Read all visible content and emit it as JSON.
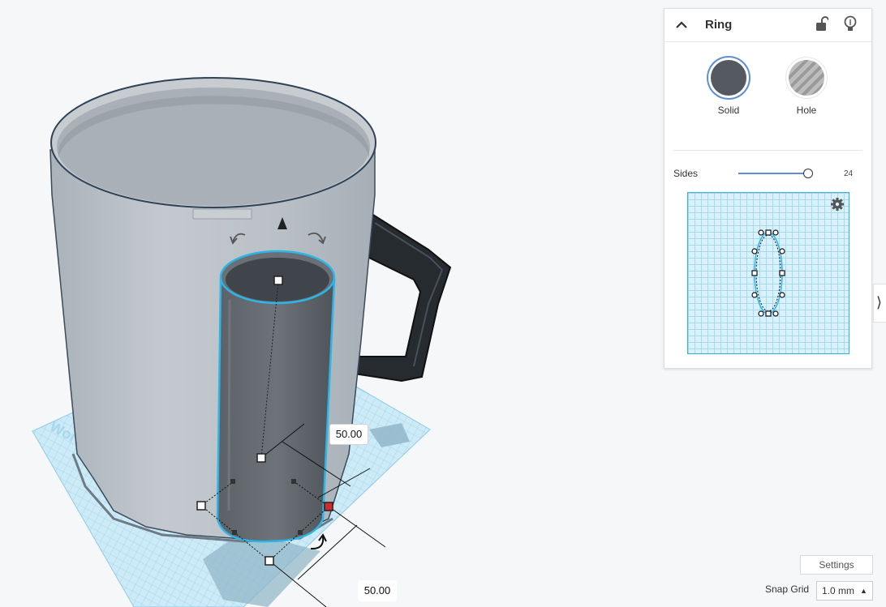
{
  "inspector": {
    "shape_name": "Ring",
    "modes": {
      "solid_label": "Solid",
      "hole_label": "Hole",
      "selected": "Solid"
    },
    "sides": {
      "label": "Sides",
      "value": "24",
      "level": 24
    }
  },
  "viewport": {
    "workplane_text": "Workplane",
    "dim_depth": "50.00",
    "dim_width": "50.00"
  },
  "bottom_bar": {
    "settings_label": "Settings",
    "snap_grid_label": "Snap Grid",
    "snap_grid_value": "1.0 mm"
  },
  "colors": {
    "accent": "#5b8ed8",
    "selection": "#2cb5e6",
    "solid_swatch": "#545a60",
    "mug": "#b5bcc3",
    "handle": "#262b30",
    "grid": "#a8d9ef"
  },
  "icons": [
    "chevron-up-icon",
    "unlock-icon",
    "lightbulb-icon",
    "gear-icon",
    "chevron-right-icon",
    "rotate-arrow-icon",
    "cone-arrow-icon"
  ]
}
